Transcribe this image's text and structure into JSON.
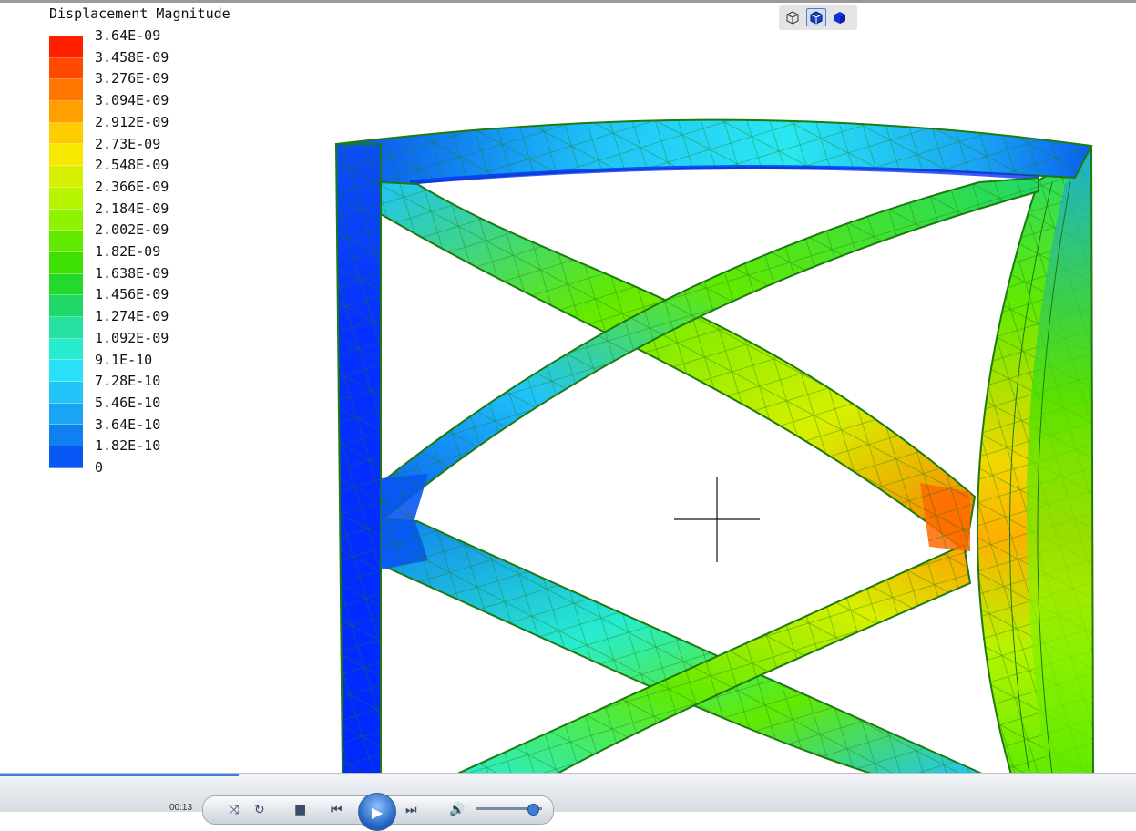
{
  "legend": {
    "title": "Displacement Magnitude",
    "labels": [
      "3.64E-09",
      "3.458E-09",
      "3.276E-09",
      "3.094E-09",
      "2.912E-09",
      "2.73E-09",
      "2.548E-09",
      "2.366E-09",
      "2.184E-09",
      "2.002E-09",
      "1.82E-09",
      "1.638E-09",
      "1.456E-09",
      "1.274E-09",
      "1.092E-09",
      "9.1E-10",
      "7.28E-10",
      "5.46E-10",
      "3.64E-10",
      "1.82E-10",
      "0"
    ],
    "colors": [
      "#ff2000",
      "#ff4a00",
      "#ff7500",
      "#ffa000",
      "#ffcc00",
      "#f6e800",
      "#d8f000",
      "#b6f400",
      "#8ef200",
      "#62ea00",
      "#3de000",
      "#24d82c",
      "#20d868",
      "#26e0a0",
      "#28ecd0",
      "#2ae0f8",
      "#20c4f8",
      "#1aa4f4",
      "#1080f0",
      "#0856f4",
      "#0030ff"
    ]
  },
  "view_toolbar": {
    "buttons": [
      {
        "name": "wireframe-view-icon",
        "active": false
      },
      {
        "name": "shaded-edges-view-icon",
        "active": true
      },
      {
        "name": "solid-view-icon",
        "active": false
      }
    ]
  },
  "player": {
    "time": "00:13"
  },
  "colors": {
    "mesh_line": "#1d7a10",
    "crosshair": "#111111",
    "background": "#ffffff"
  }
}
